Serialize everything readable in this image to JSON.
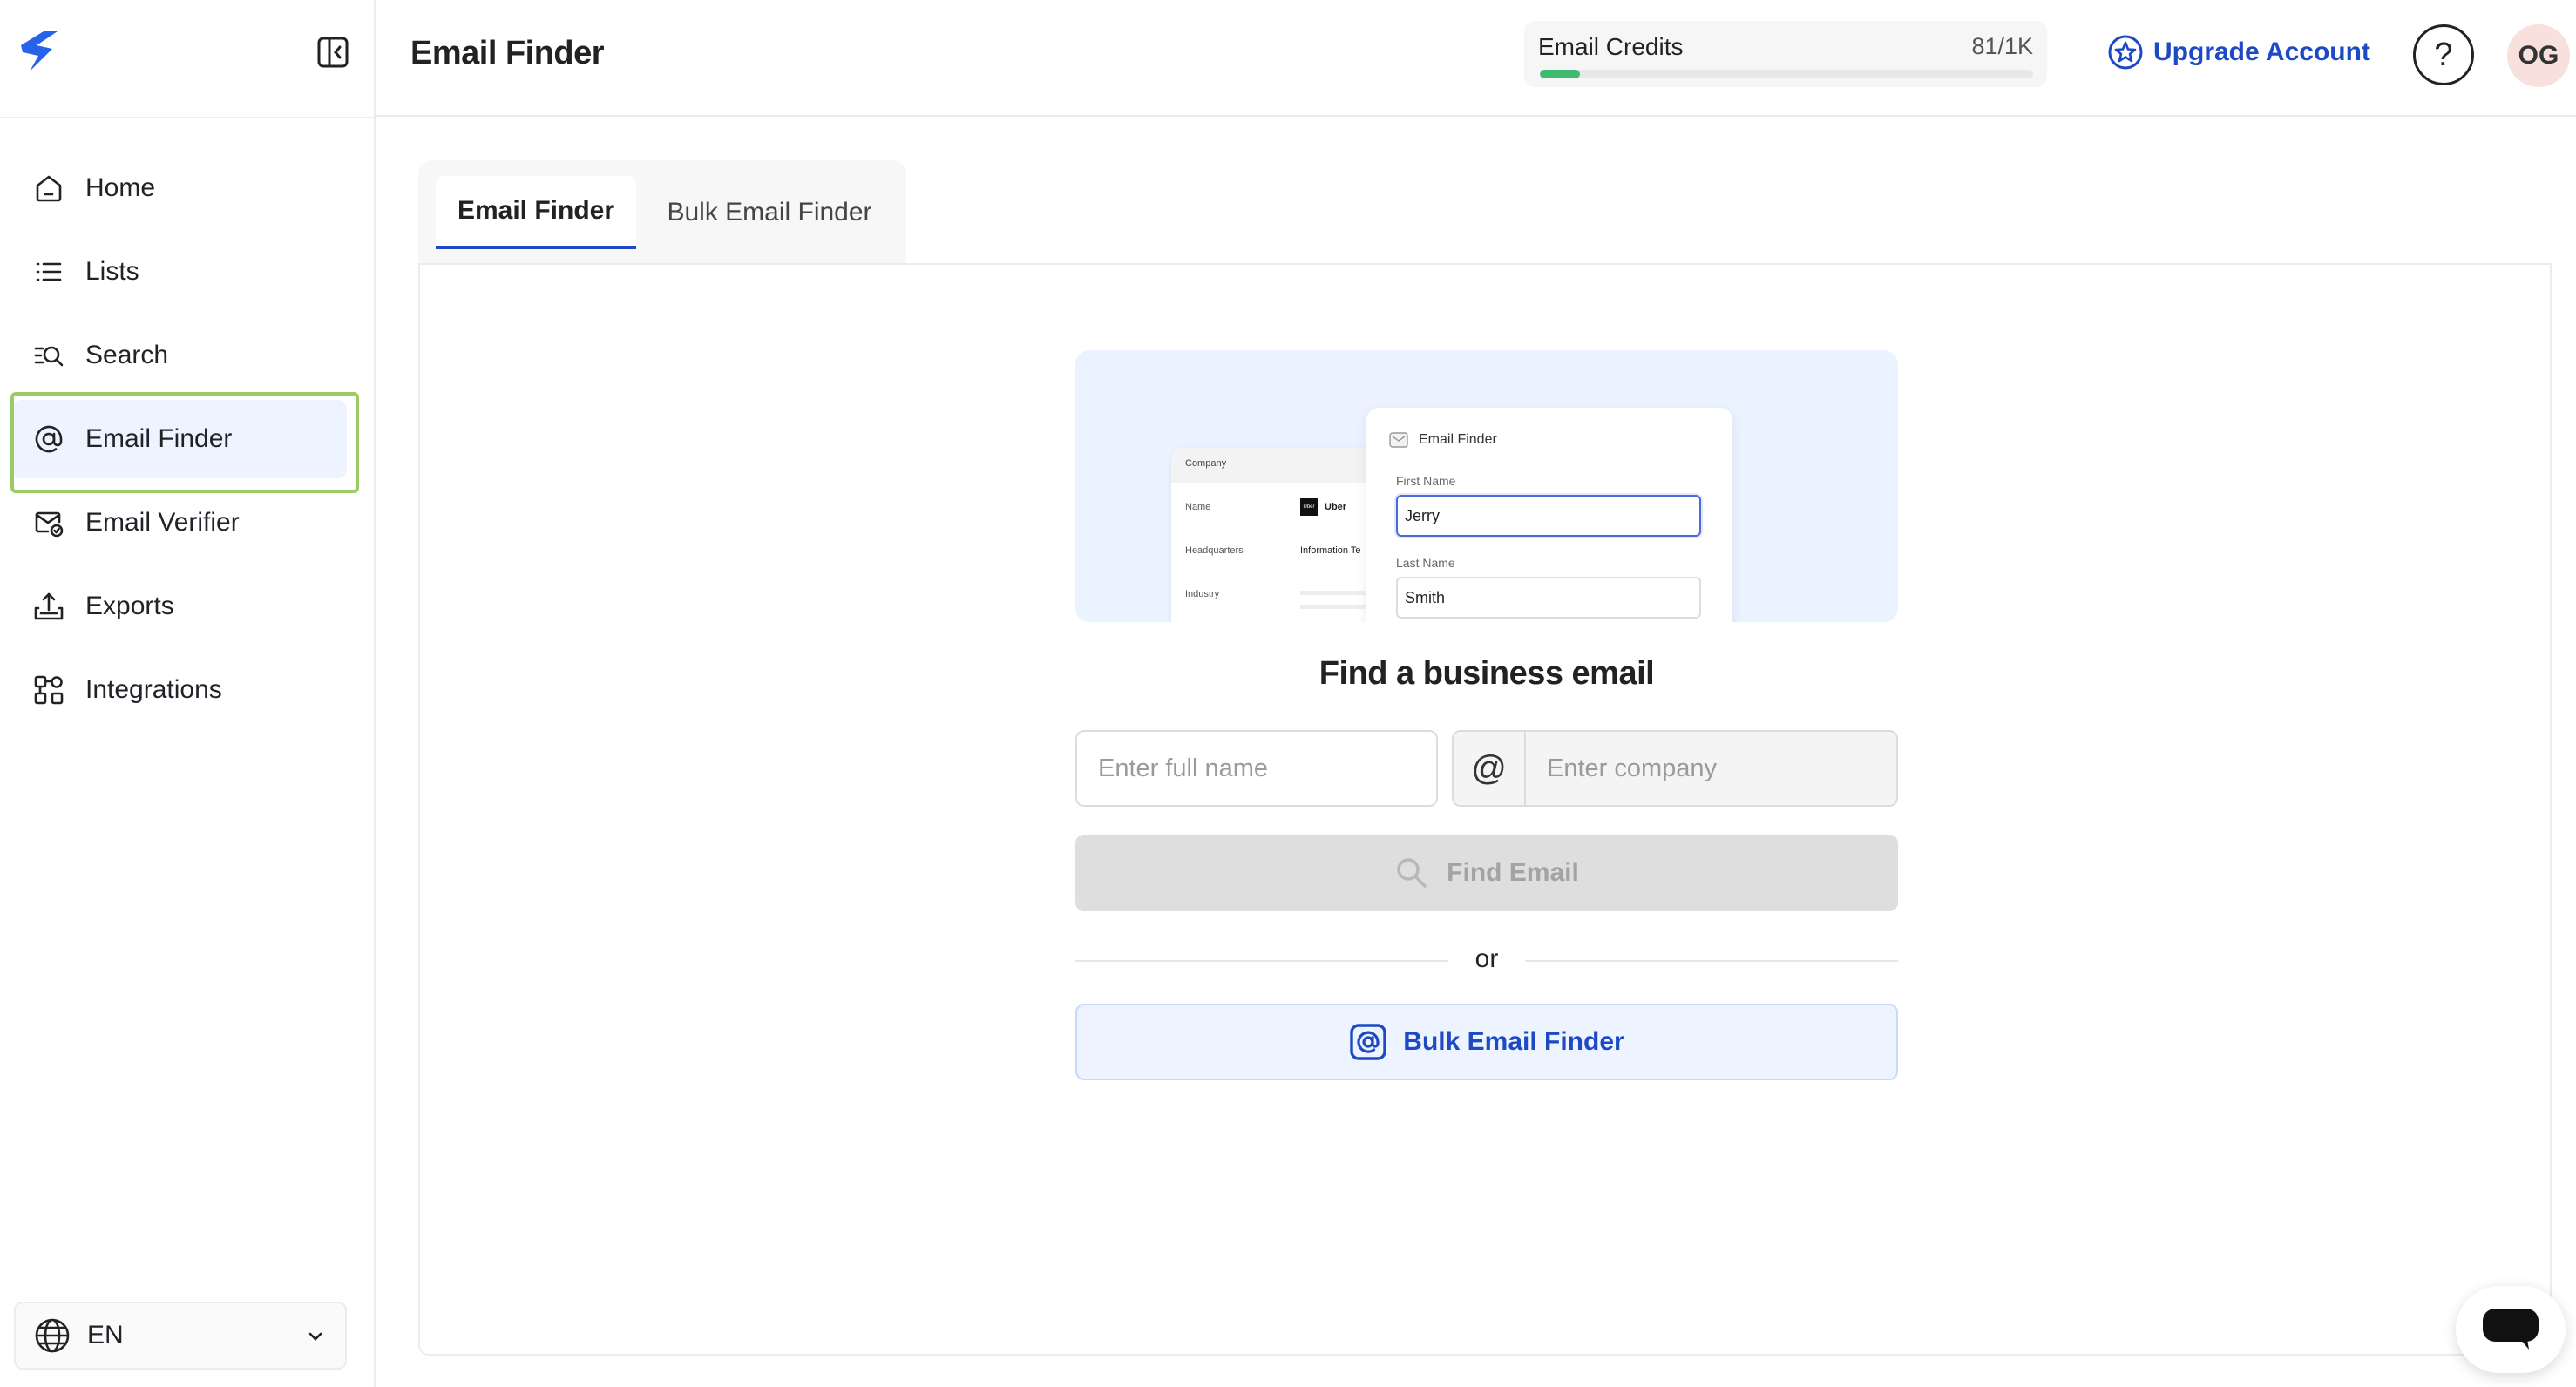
{
  "sidebar": {
    "items": [
      {
        "label": "Home",
        "icon": "home-icon"
      },
      {
        "label": "Lists",
        "icon": "list-icon"
      },
      {
        "label": "Search",
        "icon": "search-list-icon"
      },
      {
        "label": "Email Finder",
        "icon": "at-sign-icon",
        "active": true
      },
      {
        "label": "Email Verifier",
        "icon": "mail-check-icon"
      },
      {
        "label": "Exports",
        "icon": "export-icon"
      },
      {
        "label": "Integrations",
        "icon": "integrations-icon"
      }
    ],
    "language": "EN"
  },
  "header": {
    "title": "Email Finder",
    "credits_label": "Email Credits",
    "credits_count": "81/1K",
    "credits_fraction": 0.081,
    "upgrade_label": "Upgrade Account",
    "help_label": "?",
    "avatar_initials": "OG"
  },
  "tabs": [
    {
      "label": "Email Finder",
      "active": true
    },
    {
      "label": "Bulk Email Finder",
      "active": false
    }
  ],
  "illustration": {
    "back_card": {
      "header": "Company",
      "rows": [
        {
          "label": "Name",
          "value": "Uber"
        },
        {
          "label": "Headquarters",
          "value": "Information Te"
        },
        {
          "label": "Industry",
          "value": ""
        }
      ],
      "logo_text": "Uber"
    },
    "front_card": {
      "title": "Email Finder",
      "first_name_label": "First Name",
      "first_name_value": "Jerry",
      "last_name_label": "Last Name",
      "last_name_value": "Smith"
    }
  },
  "form": {
    "heading": "Find a business email",
    "name_placeholder": "Enter full name",
    "at_symbol": "@",
    "company_placeholder": "Enter company",
    "find_label": "Find Email",
    "or_label": "or",
    "bulk_label": "Bulk Email Finder"
  },
  "colors": {
    "accent": "#1d49c4",
    "active_bg": "#edf4ff",
    "highlight_border": "#9bcc64",
    "credits_bar": "#3dba6f"
  }
}
